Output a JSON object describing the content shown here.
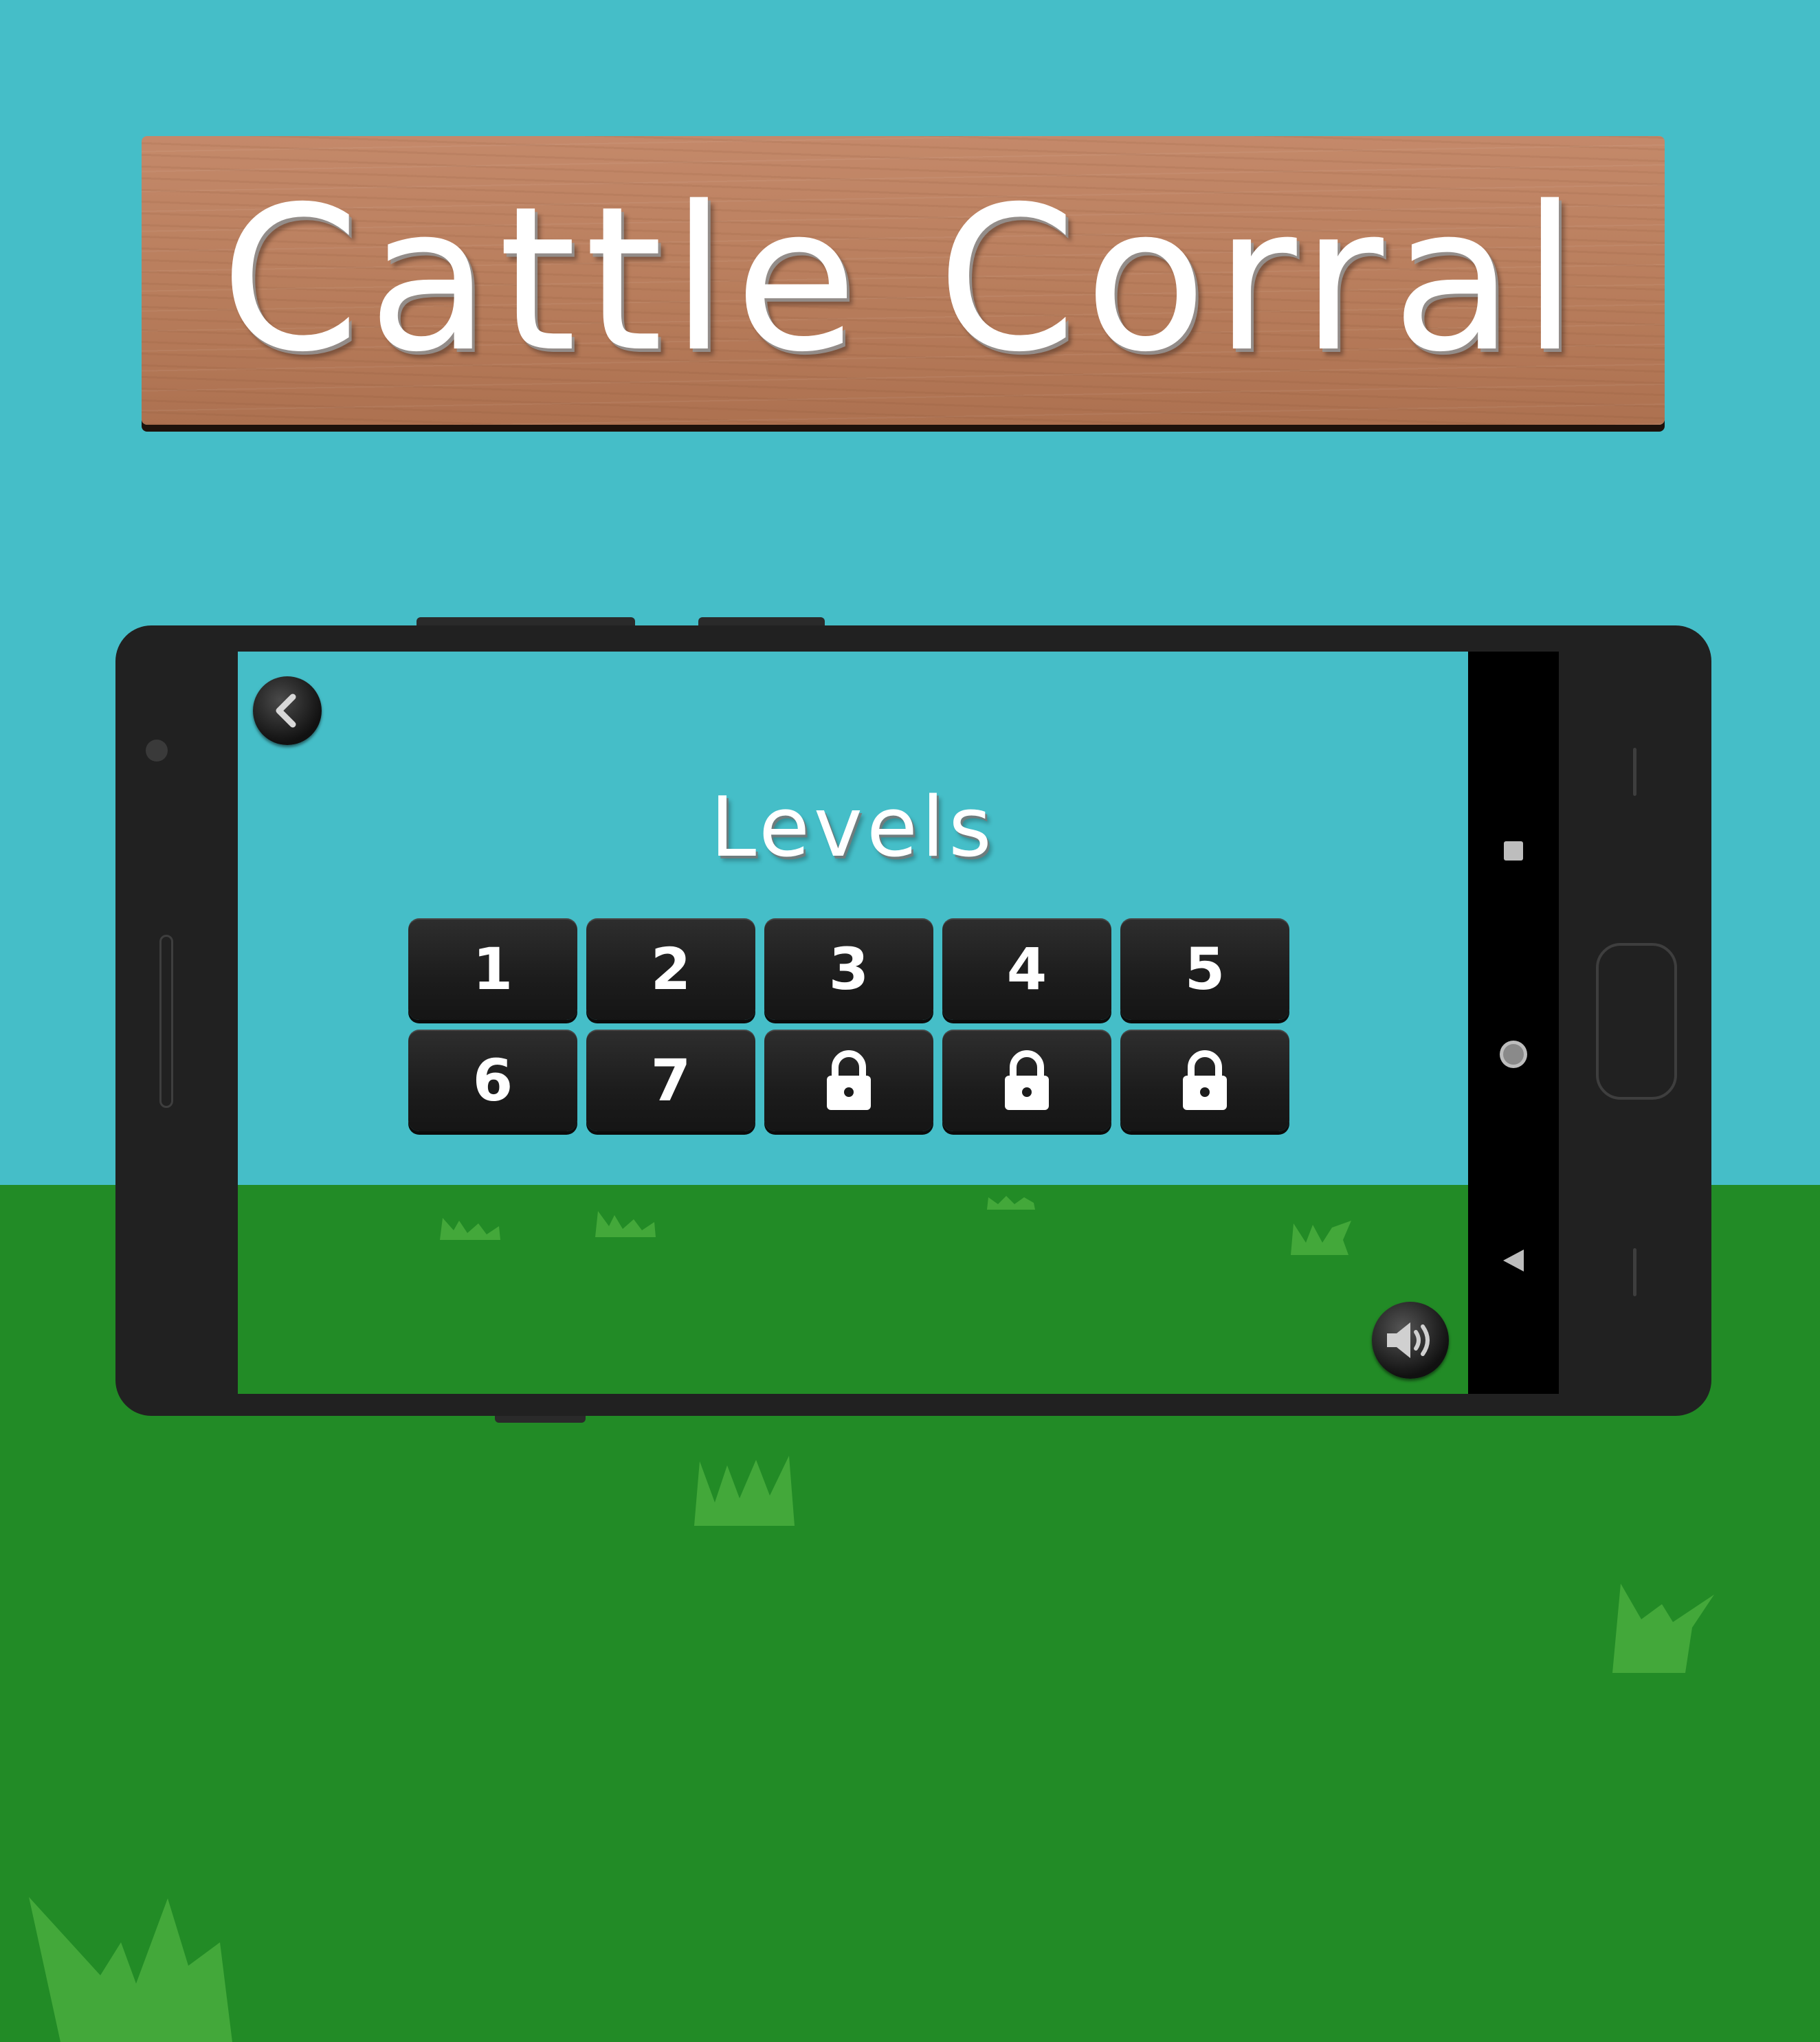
{
  "game": {
    "title": "Cattle Corral",
    "screen_title": "Levels"
  },
  "levels": [
    {
      "label": "1",
      "locked": false
    },
    {
      "label": "2",
      "locked": false
    },
    {
      "label": "3",
      "locked": false
    },
    {
      "label": "4",
      "locked": false
    },
    {
      "label": "5",
      "locked": false
    },
    {
      "label": "6",
      "locked": false
    },
    {
      "label": "7",
      "locked": false
    },
    {
      "label": "",
      "locked": true
    },
    {
      "label": "",
      "locked": true
    },
    {
      "label": "",
      "locked": true
    }
  ],
  "icons": {
    "back": "chevron-left-icon",
    "sound": "speaker-icon",
    "lock": "lock-icon",
    "nav_recents": "square-icon",
    "nav_home": "circle-icon",
    "nav_back": "triangle-left-icon"
  },
  "colors": {
    "sky": "#45bec8",
    "grass": "#228b26",
    "grass_tuft": "#43a83a",
    "sign_wood": "#b97e5d",
    "phone_body": "#212121",
    "button": "#1c1c1c"
  }
}
